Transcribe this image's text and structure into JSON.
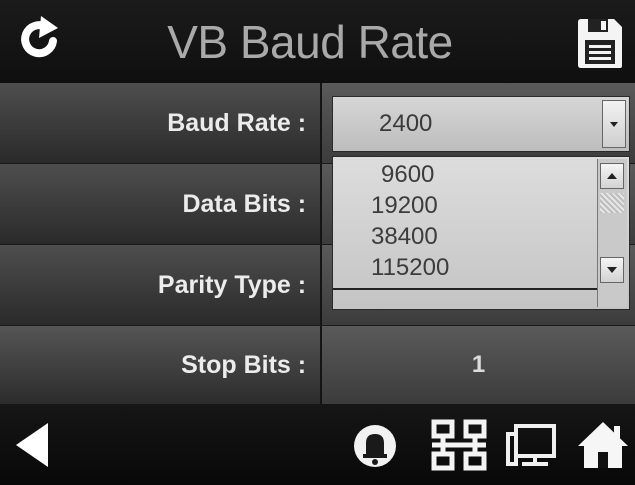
{
  "header": {
    "title": "VB Baud Rate",
    "refresh_icon": "refresh-icon",
    "save_icon": "save-icon"
  },
  "form": {
    "baud_rate": {
      "label": "Baud Rate :",
      "value": "2400"
    },
    "data_bits": {
      "label": "Data Bits :"
    },
    "parity_type": {
      "label": "Parity Type :"
    },
    "stop_bits": {
      "label": "Stop Bits :",
      "value": "1"
    }
  },
  "dropdown": {
    "options": [
      "9600",
      "19200",
      "38400",
      "115200"
    ]
  },
  "navbar": {
    "icons": [
      "back-arrow-icon",
      "alarm-bell-icon",
      "network-icon",
      "display-icon",
      "home-icon"
    ]
  },
  "colors": {
    "background": "#141414",
    "title_text": "#a9a9a9",
    "label_text": "#ececec",
    "select_bg": "#cfcfcf"
  }
}
